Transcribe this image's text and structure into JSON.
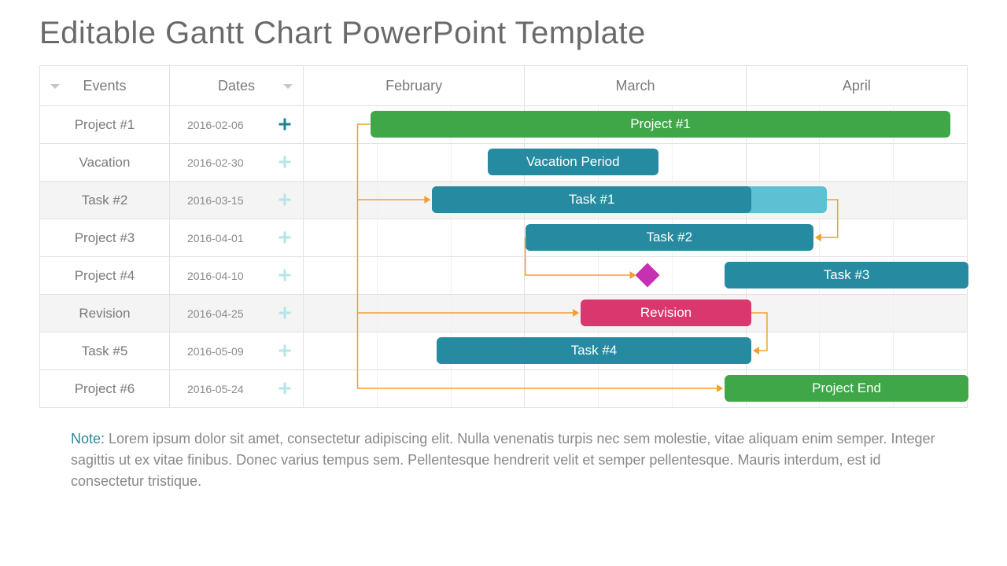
{
  "title": "Editable Gantt Chart PowerPoint Template",
  "columns": {
    "events": "Events",
    "dates": "Dates"
  },
  "months": [
    "February",
    "March",
    "April"
  ],
  "rows": [
    {
      "event": "Project #1",
      "date": "2016-02-06",
      "active": true
    },
    {
      "event": "Vacation",
      "date": "2016-02-30",
      "active": false
    },
    {
      "event": "Task #2",
      "date": "2016-03-15",
      "active": false
    },
    {
      "event": "Project #3",
      "date": "2016-04-01",
      "active": false
    },
    {
      "event": "Project #4",
      "date": "2016-04-10",
      "active": false
    },
    {
      "event": "Revision",
      "date": "2016-04-25",
      "active": false
    },
    {
      "event": "Task #5",
      "date": "2016-05-09",
      "active": false
    },
    {
      "event": "Project #6",
      "date": "2016-05-24",
      "active": false
    }
  ],
  "bars": {
    "b0": "Project #1",
    "b1": "Vacation Period",
    "b2": "Task #1",
    "b3": "Task #2",
    "b4": "Task #3",
    "b5": "Revision",
    "b6": "Task #4",
    "b7": "Project End"
  },
  "note_label": "Note: ",
  "note_text": "Lorem ipsum dolor sit amet, consectetur adipiscing elit. Nulla venenatis turpis nec sem molestie, vitae aliquam enim semper. Integer sagittis ut ex vitae finibus. Donec varius tempus sem. Pellentesque hendrerit velit et semper pellentesque. Mauris interdum, est id consectetur tristique.",
  "colors": {
    "green": "#3fa748",
    "teal": "#268ba0",
    "ltteal": "#5ec0d3",
    "pink": "#d9376e",
    "magenta": "#c730b0",
    "orange": "#f0a030"
  },
  "chart_data": {
    "type": "gantt",
    "title": "Editable Gantt Chart PowerPoint Template",
    "time_axis_months": [
      "February",
      "March",
      "April"
    ],
    "tasks": [
      {
        "row": "Project #1",
        "date": "2016-02-06",
        "bar_label": "Project #1",
        "color": "green",
        "start_col": 0.33,
        "end_col": 2.9
      },
      {
        "row": "Vacation",
        "date": "2016-02-30",
        "bar_label": "Vacation Period",
        "color": "teal",
        "start_col": 0.83,
        "end_col": 1.58
      },
      {
        "row": "Task #2",
        "date": "2016-03-15",
        "bar_label": "Task #1",
        "color": "teal",
        "start_col": 0.58,
        "end_col": 2.0,
        "progress_end_col": 2.35,
        "progress_color": "ltteal"
      },
      {
        "row": "Project #3",
        "date": "2016-04-01",
        "bar_label": "Task #2",
        "color": "teal",
        "start_col": 1.0,
        "end_col": 2.3
      },
      {
        "row": "Project #4",
        "date": "2016-04-10",
        "milestone_col": 1.55,
        "milestone_color": "magenta",
        "bar_label": "Task #3",
        "color": "teal",
        "start_col": 1.9,
        "end_col": 3.0
      },
      {
        "row": "Revision",
        "date": "2016-04-25",
        "bar_label": "Revision",
        "color": "pink",
        "start_col": 1.25,
        "end_col": 2.0
      },
      {
        "row": "Task #5",
        "date": "2016-05-09",
        "bar_label": "Task #4",
        "color": "teal",
        "start_col": 0.6,
        "end_col": 2.0
      },
      {
        "row": "Project #6",
        "date": "2016-05-24",
        "bar_label": "Project End",
        "color": "green",
        "start_col": 1.9,
        "end_col": 3.0
      }
    ],
    "dependencies": [
      {
        "from_row": 0,
        "to_row": 2
      },
      {
        "from_row": 2,
        "to_row": 3
      },
      {
        "from_row": 3,
        "to_row": 4
      },
      {
        "from_row": 5,
        "to_row": 6
      },
      {
        "from_row": 0,
        "to_row": 7
      }
    ]
  }
}
